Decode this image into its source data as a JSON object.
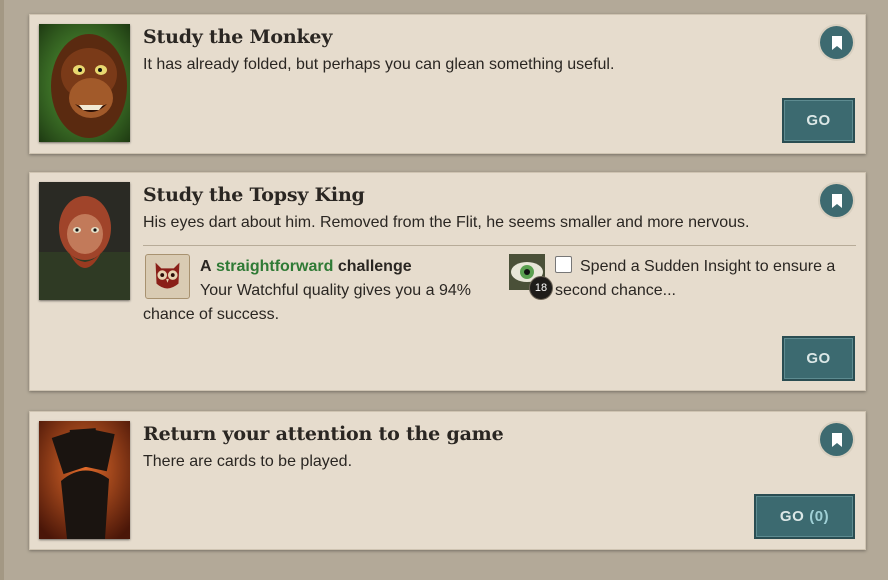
{
  "cards": [
    {
      "title": "Study the Monkey",
      "description": "It has already folded, but perhaps you can glean something useful.",
      "go_label": "GO",
      "portrait_icon": "monkey-portrait"
    },
    {
      "title": "Study the Topsy King",
      "description": "His eyes dart about him. Removed from the Flit, he seems smaller and more nervous.",
      "go_label": "GO",
      "portrait_icon": "topsy-king-portrait",
      "challenge": {
        "prefix": "A",
        "difficulty": "straightforward",
        "suffix": "challenge",
        "text": "Your Watchful quality gives you a 94% chance of success.",
        "icon": "owl-icon"
      },
      "insight": {
        "text": "Spend a Sudden Insight to ensure a second chance...",
        "count": "18",
        "icon": "eye-icon"
      }
    },
    {
      "title": "Return your attention to the game",
      "description": "There are cards to be played.",
      "go_label": "GO",
      "go_count": "(0)",
      "portrait_icon": "cards-hand-portrait"
    }
  ],
  "colors": {
    "card_bg": "#e6dccd",
    "button_bg": "#3c6a70",
    "challenge_green": "#2f7a35"
  }
}
